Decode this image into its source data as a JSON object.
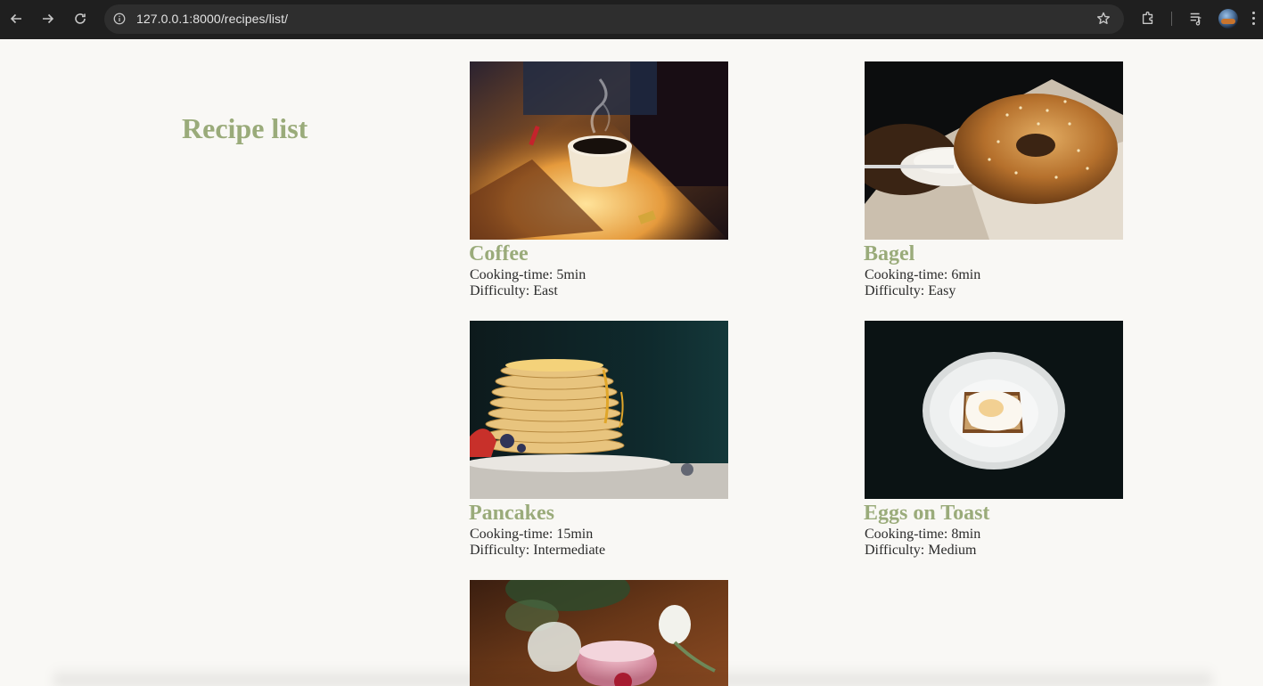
{
  "browser": {
    "url": "127.0.0.1:8000/recipes/list/",
    "icons": [
      "back-arrow-icon",
      "forward-arrow-icon",
      "reload-icon",
      "site-info-icon",
      "bookmark-star-icon",
      "extensions-icon",
      "media-controls-icon",
      "profile-avatar",
      "menu-kebab-icon"
    ]
  },
  "page": {
    "title": "Recipe list",
    "accent_color": "#9aab7a",
    "background_color": "#f9f8f5"
  },
  "recipes": [
    {
      "name": "Coffee",
      "cooking_time": "Cooking-time: 5min",
      "difficulty": "Difficulty: East",
      "image": "coffee-photo"
    },
    {
      "name": "Bagel",
      "cooking_time": "Cooking-time: 6min",
      "difficulty": "Difficulty: Easy",
      "image": "bagel-photo"
    },
    {
      "name": "Pancakes",
      "cooking_time": "Cooking-time: 15min",
      "difficulty": "Difficulty: Intermediate",
      "image": "pancakes-photo"
    },
    {
      "name": "Eggs on Toast",
      "cooking_time": "Cooking-time: 8min",
      "difficulty": "Difficulty: Medium",
      "image": "eggs-on-toast-photo"
    },
    {
      "name": "",
      "cooking_time": "",
      "difficulty": "",
      "image": "smoothie-photo"
    }
  ]
}
